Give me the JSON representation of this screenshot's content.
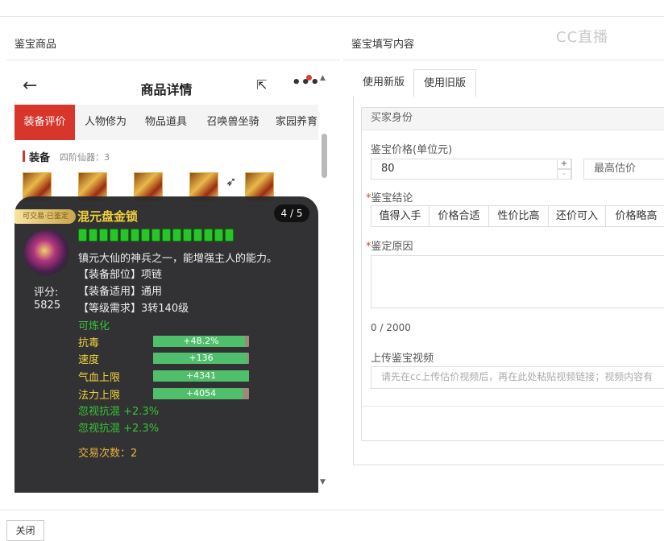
{
  "left_section_title": "鉴宝商品",
  "right_section_title": "鉴宝填写内容",
  "watermark": "CC直播",
  "phone": {
    "title": "商品详情",
    "tabs": [
      "装备评价",
      "人物修为",
      "物品道具",
      "召唤兽坐骑",
      "家园养育"
    ],
    "equip_label": "装备",
    "equip_sub": "四阶仙器：3",
    "popup": {
      "badge": "可交易·已鉴定",
      "item_name": "混元盘金锁",
      "pager": "4 / 5",
      "gem_count": 15,
      "description": "镇元大仙的神兵之一，能增强主人的能力。",
      "attrs": [
        "【装备部位】项链",
        "【装备适用】通用",
        "【等级需求】3转140级"
      ],
      "score_label": "评分:",
      "score_value": "5825",
      "refine": "可炼化",
      "stats": [
        {
          "name": "抗毒",
          "value": "+48.2%",
          "fill": 0.96
        },
        {
          "name": "速度",
          "value": "+136",
          "fill": 0.98
        },
        {
          "name": "气血上限",
          "value": "+4341",
          "fill": 1.0
        },
        {
          "name": "法力上限",
          "value": "+4054",
          "fill": 0.93
        }
      ],
      "specials": [
        "忽视抗混 +2.3%",
        "忽视抗混 +2.3%"
      ],
      "trade_count": "交易次数：2"
    }
  },
  "form": {
    "tabs": [
      "使用新版",
      "使用旧版"
    ],
    "active_tab": 1,
    "card_title": "买家身份",
    "price_label": "鉴宝价格(单位元)",
    "price_value": "80",
    "estimate_placeholder": "最高估价",
    "conclusion_label": "鉴宝结论",
    "conclusion_options": [
      "值得入手",
      "价格合适",
      "性价比高",
      "还价可入",
      "价格略高"
    ],
    "reason_label": "鉴定原因",
    "reason_counter": "0 / 2000",
    "video_label": "上传鉴宝视频",
    "video_placeholder": "请先在cc上传估价视频后，再在此处粘贴视频链接；视频内容有"
  },
  "close_label": "关闭",
  "colors": {
    "accent": "#d9362b",
    "gem": "#27c527",
    "gold": "#f3d23a",
    "green_text": "#35c435"
  }
}
